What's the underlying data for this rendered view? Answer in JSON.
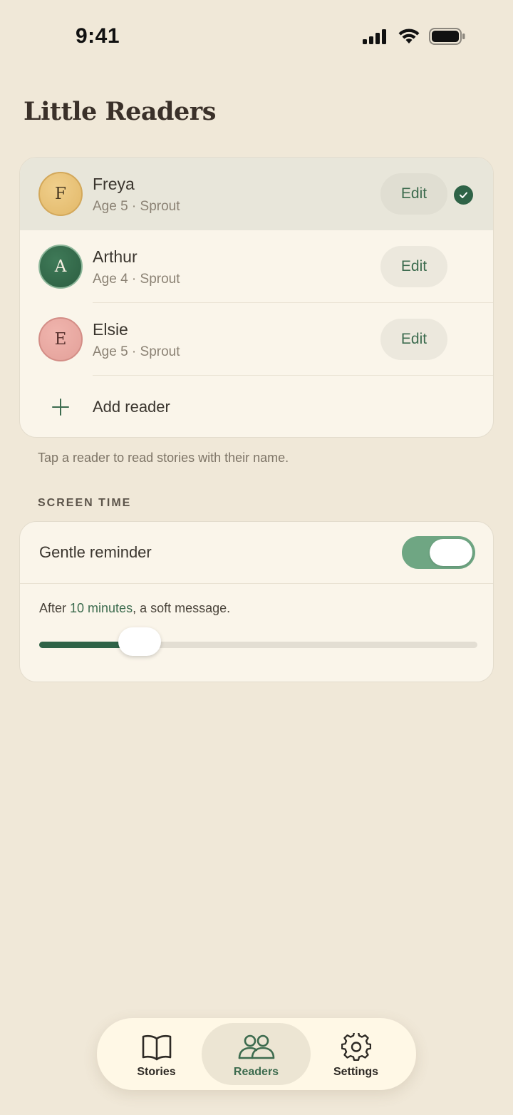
{
  "status_bar": {
    "time": "9:41"
  },
  "page": {
    "title": "Little Readers"
  },
  "readers": [
    {
      "initial": "F",
      "name": "Freya",
      "subtitle": "Age 5 · Sprout",
      "edit_label": "Edit",
      "selected": true
    },
    {
      "initial": "A",
      "name": "Arthur",
      "subtitle": "Age 4 · Sprout",
      "edit_label": "Edit",
      "selected": false
    },
    {
      "initial": "E",
      "name": "Elsie",
      "subtitle": "Age 5 · Sprout",
      "edit_label": "Edit",
      "selected": false
    }
  ],
  "add_reader": {
    "label": "Add reader"
  },
  "helper_text": "Tap a reader to read stories with their name.",
  "screen_time": {
    "section_label": "SCREEN TIME",
    "reminder_label": "Gentle reminder",
    "reminder_enabled": true,
    "after_prefix": "After ",
    "after_value": "10 minutes",
    "after_suffix": ", a soft message.",
    "slider_fraction": 0.23
  },
  "tabs": [
    {
      "label": "Stories",
      "icon": "book-icon",
      "active": false
    },
    {
      "label": "Readers",
      "icon": "people-icon",
      "active": true
    },
    {
      "label": "Settings",
      "icon": "gear-icon",
      "active": false
    }
  ],
  "colors": {
    "background": "#F0E8D8",
    "accent": "#3C6B4E",
    "toggle_on": "#6FA683"
  }
}
